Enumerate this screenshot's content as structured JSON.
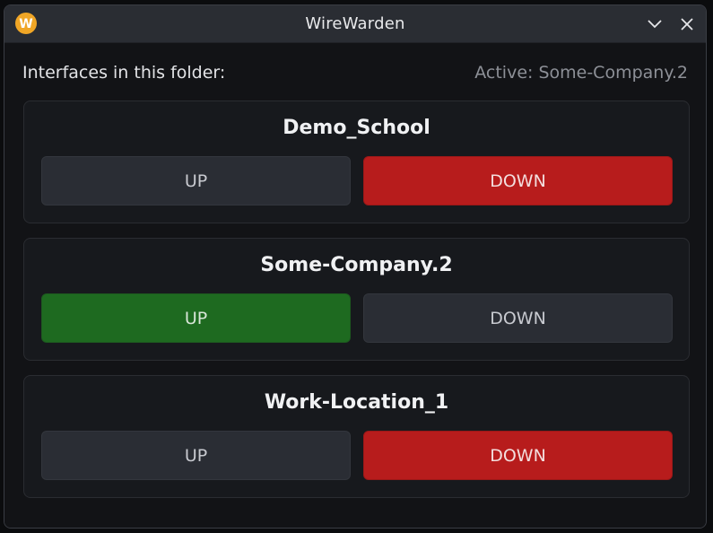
{
  "window": {
    "title": "WireWarden",
    "logo_icon": "wirewarden-logo-icon",
    "logo_letter": "W",
    "accent_color": "#f0a626",
    "controls": [
      "chevron-down-icon",
      "close-icon"
    ]
  },
  "header": {
    "folder_label": "Interfaces in this folder:",
    "active_label": "Active: Some-Company.2"
  },
  "colors": {
    "up_active": "#1e6a20",
    "down_active": "#b71c1c",
    "neutral": "#2a2d34"
  },
  "interfaces": [
    {
      "name": "Demo_School",
      "up_label": "UP",
      "down_label": "DOWN",
      "state": "down"
    },
    {
      "name": "Some-Company.2",
      "up_label": "UP",
      "down_label": "DOWN",
      "state": "up"
    },
    {
      "name": "Work-Location_1",
      "up_label": "UP",
      "down_label": "DOWN",
      "state": "down"
    }
  ]
}
